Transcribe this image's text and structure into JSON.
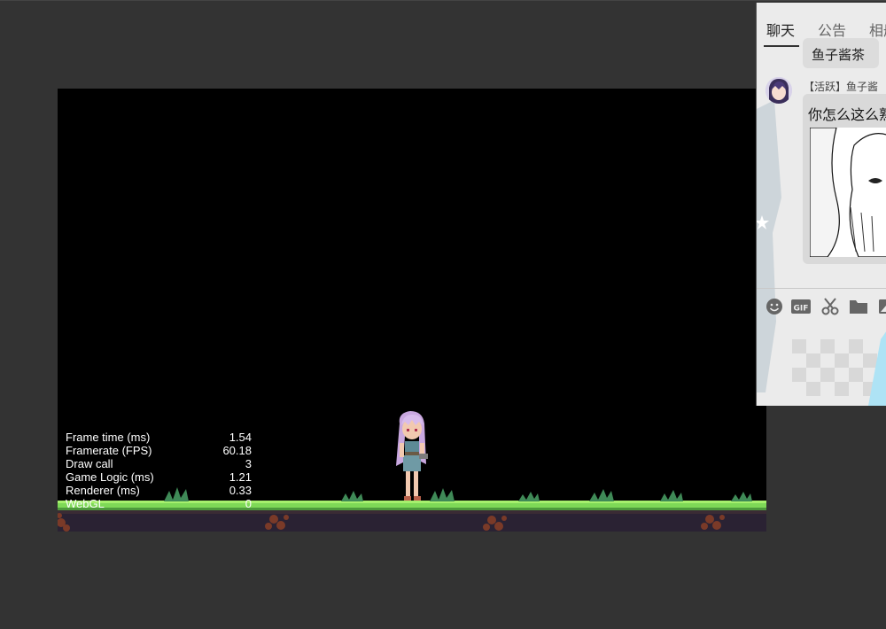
{
  "stats": [
    {
      "label": "Frame time (ms)",
      "value": "1.54"
    },
    {
      "label": "Framerate (FPS)",
      "value": "60.18"
    },
    {
      "label": "Draw call",
      "value": "3"
    },
    {
      "label": "Game Logic (ms)",
      "value": "1.21"
    },
    {
      "label": "Renderer (ms)",
      "value": "0.33"
    },
    {
      "label": "WebGL",
      "value": "0"
    }
  ],
  "chat": {
    "tabs": [
      {
        "label": "聊天"
      },
      {
        "label": "公告"
      },
      {
        "label": "相册"
      }
    ],
    "previous_message": "鱼子酱茶",
    "message": {
      "meta": "【活跃】鱼子酱",
      "text": "你怎么这么熟"
    },
    "toolbar": [
      {
        "icon": "emoji-icon"
      },
      {
        "icon": "gif-icon"
      },
      {
        "icon": "scissors-icon"
      },
      {
        "icon": "folder-icon"
      },
      {
        "icon": "image-icon"
      }
    ]
  },
  "colors": {
    "page_background": "#333333",
    "game_background": "#000000",
    "grass": "#7ed957",
    "soil": "#2a2233",
    "chat_background": "#eaeaea"
  }
}
